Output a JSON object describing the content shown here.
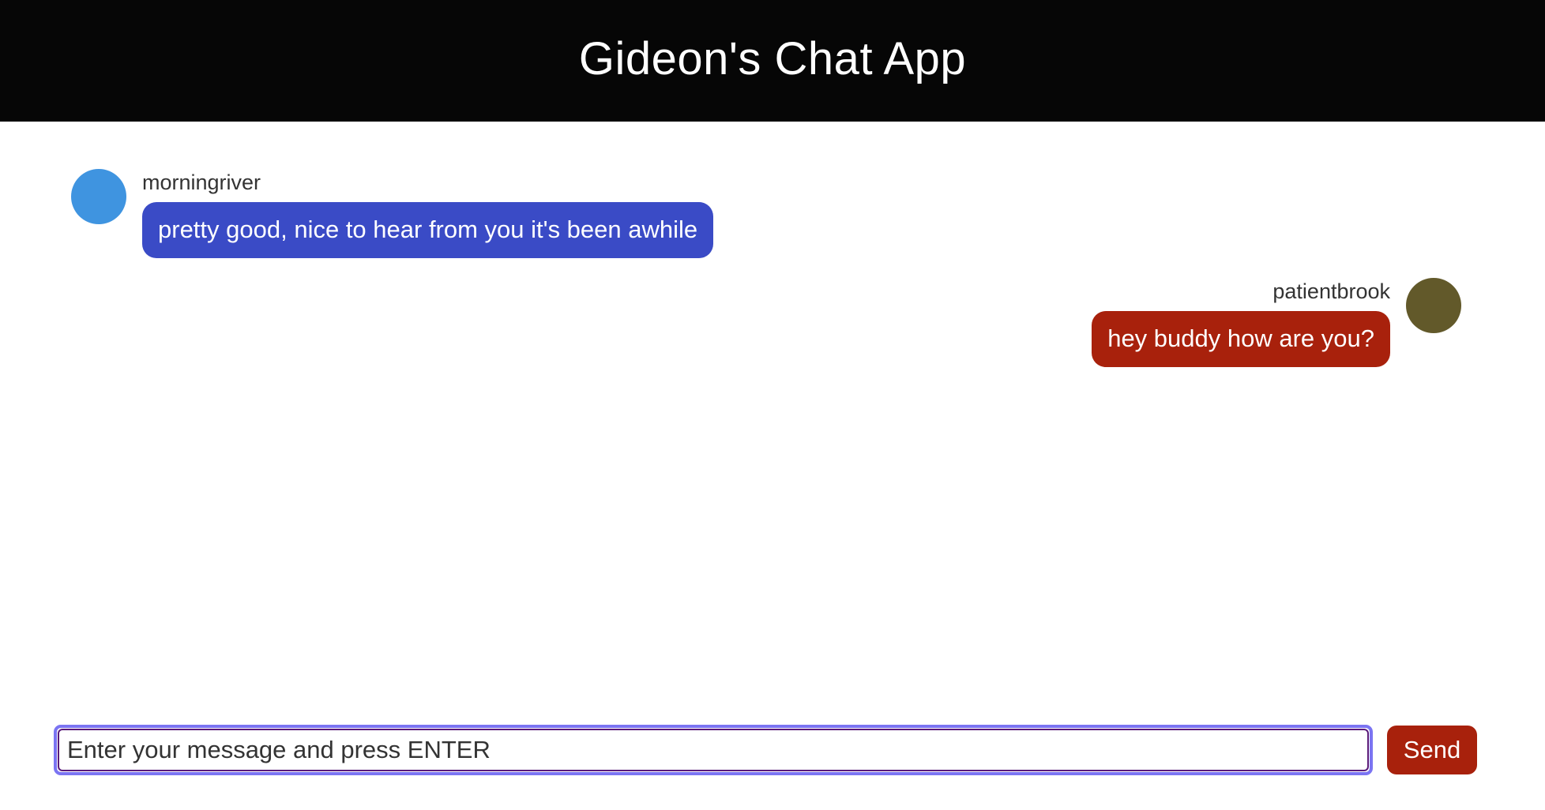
{
  "header": {
    "title": "Gideon's Chat App"
  },
  "messages": [
    {
      "side": "left",
      "username": "morningriver",
      "text": "pretty good, nice to hear from you it's been awhile",
      "avatar_color": "#3f94e0",
      "bubble_color": "#3a4bc6"
    },
    {
      "side": "right",
      "username": "patientbrook",
      "text": "hey buddy how are you?",
      "avatar_color": "#62592a",
      "bubble_color": "#a8210c"
    }
  ],
  "composer": {
    "placeholder": "Enter your message and press ENTER",
    "value": "",
    "send_label": "Send",
    "send_color": "#a8210c",
    "focus_ring_color": "#7b74f2"
  },
  "colors": {
    "header_bg": "#060606",
    "page_bg": "#ffffff"
  }
}
